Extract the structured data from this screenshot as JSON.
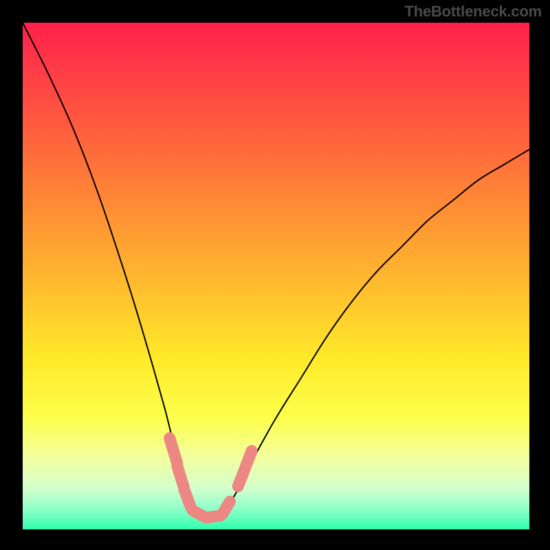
{
  "brand": "TheBottleneck.com",
  "colors": {
    "curve": "#000000",
    "marks": "#ed8784",
    "gradient_top": "#ff1f4a",
    "gradient_bottom": "#2fffae"
  },
  "chart_data": {
    "type": "line",
    "title": "",
    "xlabel": "",
    "ylabel": "",
    "xlim": [
      0,
      1
    ],
    "ylim": [
      0,
      1
    ],
    "axes_visible": false,
    "grid": false,
    "note": "Y value is the bottleneck fraction (0 at bottom/green = ideal, 1 at top/red = severe). Curve minimum ~x=0.36. Values estimated from pixel position against gradient.",
    "series": [
      {
        "name": "bottleneck-curve",
        "x": [
          0.0,
          0.05,
          0.1,
          0.15,
          0.2,
          0.24,
          0.28,
          0.3,
          0.32,
          0.34,
          0.36,
          0.38,
          0.4,
          0.42,
          0.45,
          0.5,
          0.55,
          0.6,
          0.65,
          0.7,
          0.75,
          0.8,
          0.85,
          0.9,
          0.95,
          1.0
        ],
        "y": [
          1.0,
          0.9,
          0.79,
          0.66,
          0.51,
          0.38,
          0.24,
          0.16,
          0.09,
          0.04,
          0.02,
          0.02,
          0.04,
          0.07,
          0.13,
          0.22,
          0.3,
          0.38,
          0.45,
          0.51,
          0.56,
          0.61,
          0.65,
          0.69,
          0.72,
          0.75
        ]
      }
    ],
    "optimal_zone_marks": {
      "note": "Thick pink dashes indicating the low-bottleneck zone around the curve minimum.",
      "segments": [
        {
          "x1": 0.29,
          "y1": 0.18,
          "x2": 0.305,
          "y2": 0.13
        },
        {
          "x1": 0.305,
          "y1": 0.125,
          "x2": 0.318,
          "y2": 0.083
        },
        {
          "x1": 0.319,
          "y1": 0.078,
          "x2": 0.332,
          "y2": 0.043
        },
        {
          "x1": 0.336,
          "y1": 0.037,
          "x2": 0.36,
          "y2": 0.024
        },
        {
          "x1": 0.362,
          "y1": 0.023,
          "x2": 0.39,
          "y2": 0.027
        },
        {
          "x1": 0.394,
          "y1": 0.03,
          "x2": 0.409,
          "y2": 0.055
        },
        {
          "x1": 0.425,
          "y1": 0.085,
          "x2": 0.438,
          "y2": 0.118
        },
        {
          "x1": 0.44,
          "y1": 0.124,
          "x2": 0.452,
          "y2": 0.155
        }
      ]
    }
  }
}
